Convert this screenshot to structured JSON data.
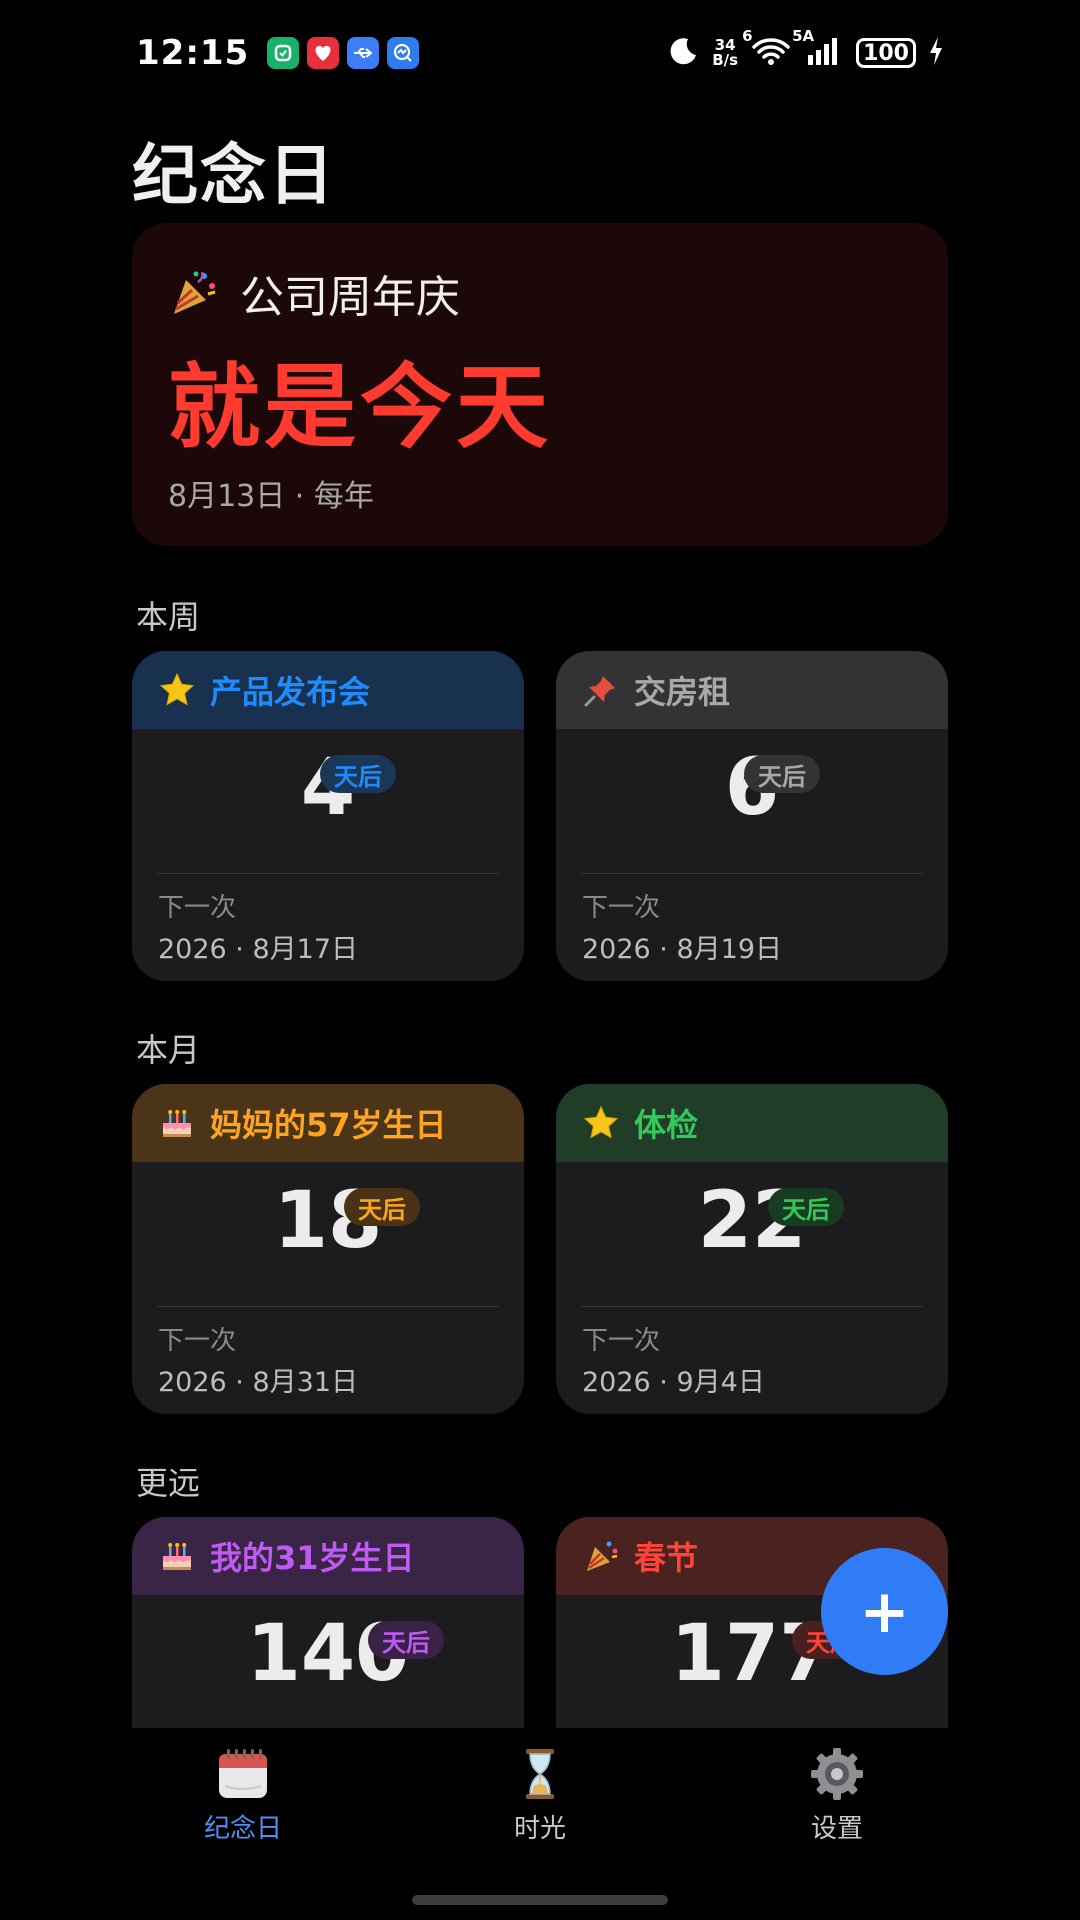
{
  "status_bar": {
    "time": "12:15",
    "net_speed_value": "34",
    "net_speed_unit": "B/s",
    "wifi_label": "6",
    "signal_label": "5A",
    "battery": "100"
  },
  "page": {
    "title": "纪念日"
  },
  "hero": {
    "icon": "party-popper-icon",
    "name": "公司周年庆",
    "status": "就是今天",
    "date": "8月13日 · 每年"
  },
  "sections": {
    "this_week": "本周",
    "this_month": "本月",
    "later": "更远"
  },
  "cards": [
    {
      "icon": "star-icon",
      "title": "产品发布会",
      "days": "4",
      "badge": "天后",
      "next_label": "下一次",
      "next_date": "2026 · 8月17日",
      "color": "#1e8bff",
      "head_bg": "#17314f",
      "badge_bg": "#1a3757"
    },
    {
      "icon": "pushpin-icon",
      "title": "交房租",
      "days": "6",
      "badge": "天后",
      "next_label": "下一次",
      "next_date": "2026 · 8月19日",
      "color": "#a8a8a8",
      "head_bg": "#333335",
      "badge_bg": "#333335"
    },
    {
      "icon": "cake-icon",
      "title": "妈妈的57岁生日",
      "days": "18",
      "badge": "天后",
      "next_label": "下一次",
      "next_date": "2026 · 8月31日",
      "color": "#ffa41f",
      "head_bg": "#4b3418",
      "badge_bg": "#4a3315"
    },
    {
      "icon": "star-icon",
      "title": "体检",
      "days": "22",
      "badge": "天后",
      "next_label": "下一次",
      "next_date": "2026 · 9月4日",
      "color": "#34c85a",
      "head_bg": "#1f3d27",
      "badge_bg": "#173c21"
    },
    {
      "icon": "cake-icon",
      "title": "我的31岁生日",
      "days": "140",
      "badge": "天后",
      "next_label": "",
      "next_date": "",
      "color": "#bf5af2",
      "head_bg": "#3a2546",
      "badge_bg": "#3a2246"
    },
    {
      "icon": "party-popper-icon",
      "title": "春节",
      "days": "177",
      "badge": "天后",
      "next_label": "",
      "next_date": "",
      "color": "#ff453a",
      "head_bg": "#4a2220",
      "badge_bg": "#4a201e"
    }
  ],
  "nav": {
    "items": [
      {
        "label": "纪念日",
        "icon": "calendar-icon",
        "active": true
      },
      {
        "label": "时光",
        "icon": "hourglass-icon",
        "active": false
      },
      {
        "label": "设置",
        "icon": "gear-icon",
        "active": false
      }
    ]
  },
  "fab": {
    "label": "+"
  },
  "colors": {
    "accent": "#2f7cf6",
    "hero_bg": "#1c0808",
    "hero_text": "#ff3b30",
    "card_bg": "#1c1c1e"
  }
}
